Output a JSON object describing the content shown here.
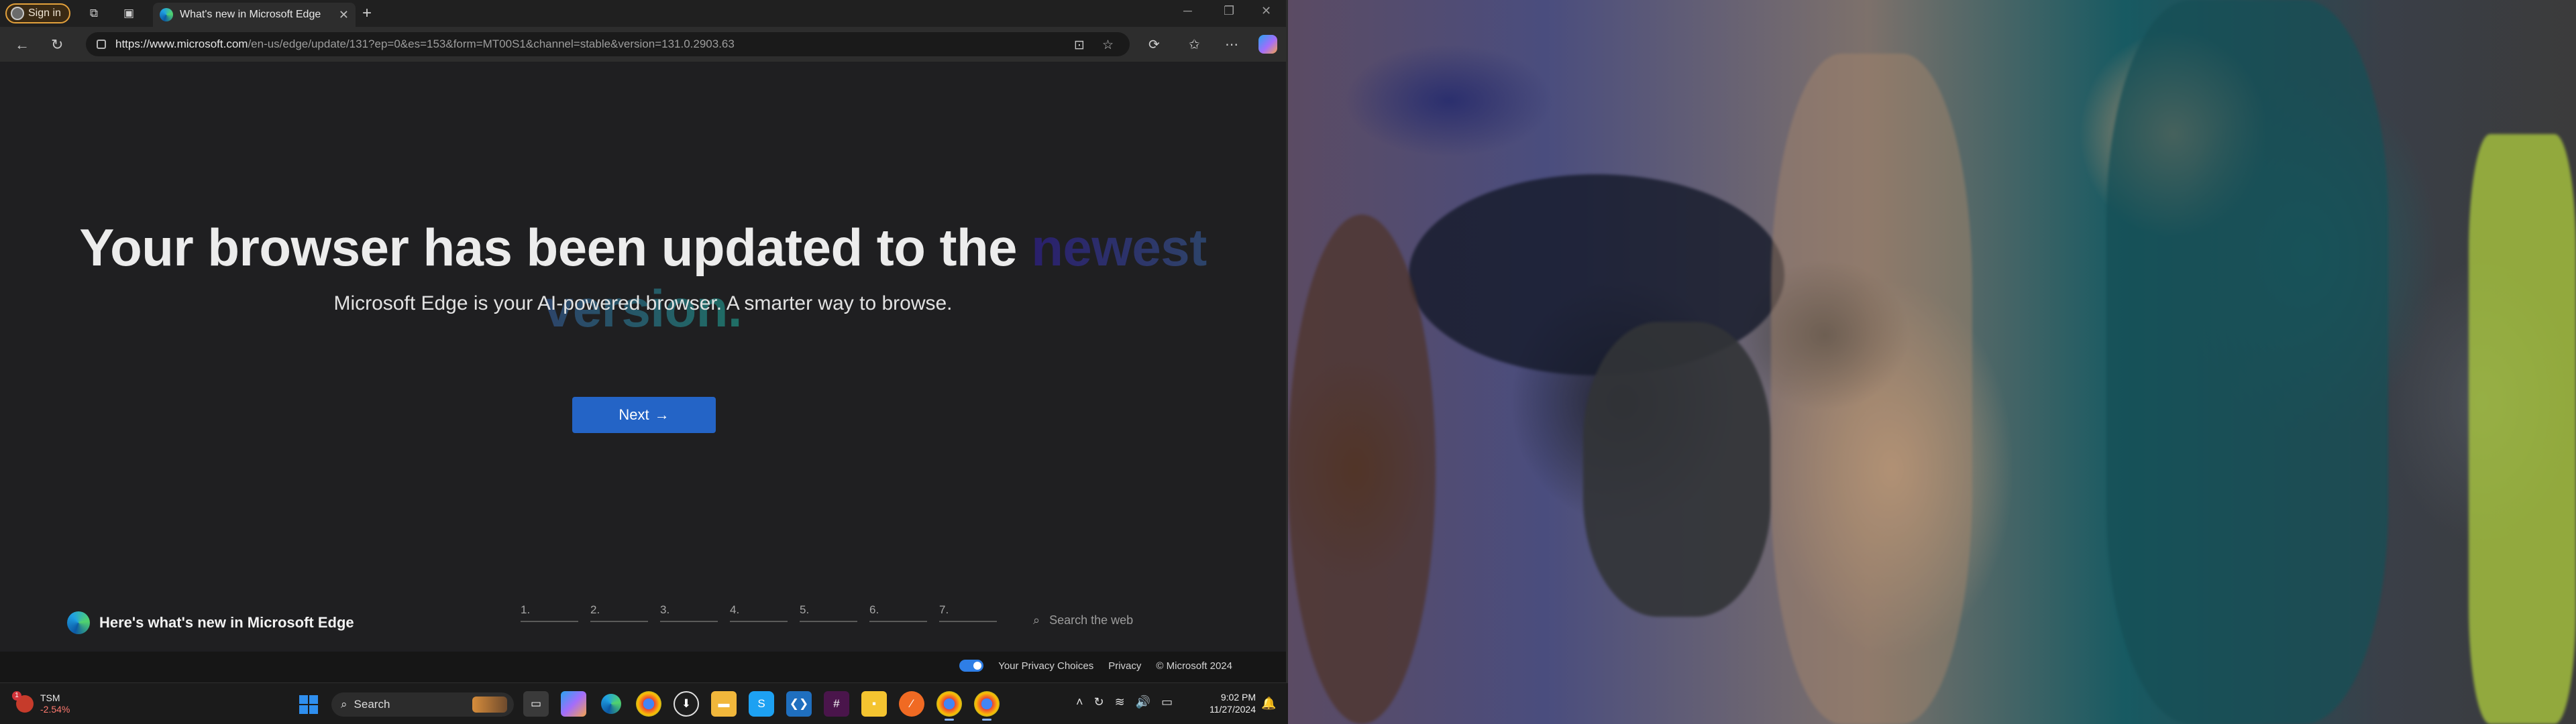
{
  "browser": {
    "signin_label": "Sign in",
    "tab_title": "What's new in Microsoft Edge",
    "url_host": "https://www.microsoft.com",
    "url_path": "/en-us/edge/update/131?ep=0&es=153&form=MT00S1&channel=stable&version=131.0.2903.63"
  },
  "page": {
    "headline_main": "Your browser has been updated to the ",
    "headline_highlight": "newest version.",
    "subheadline": "Microsoft Edge is your AI-powered browser. A smarter way to browse.",
    "next_label": "Next",
    "footer_brand": "Here's what's new in Microsoft Edge",
    "steps": [
      "1.",
      "2.",
      "3.",
      "4.",
      "5.",
      "6.",
      "7."
    ],
    "search_web_placeholder": "Search the web",
    "legal": {
      "privacy_choices": "Your Privacy Choices",
      "privacy": "Privacy",
      "copyright": "© Microsoft 2024"
    }
  },
  "taskbar": {
    "stock_symbol": "TSM",
    "stock_change": "-2.54%",
    "stock_badge": "1",
    "search_placeholder": "Search",
    "time": "9:02 PM",
    "date": "11/27/2024"
  },
  "icons": {
    "accent": "#2464c6",
    "windows_blue": "#2f8fef"
  }
}
